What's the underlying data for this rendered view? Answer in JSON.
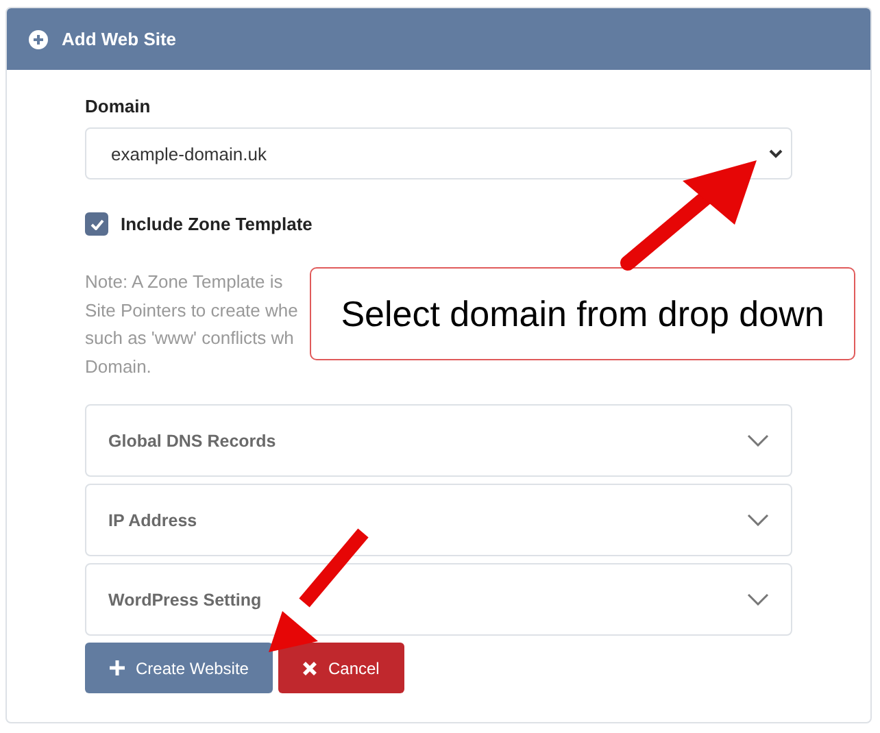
{
  "panel": {
    "title": "Add Web Site"
  },
  "domain": {
    "label": "Domain",
    "value": "example-domain.uk"
  },
  "include_zone_template": {
    "label": "Include Zone Template",
    "checked": true
  },
  "note_lines": [
    "Note: A Zone Template is",
    "Site Pointers to create whe",
    "such as 'www' conflicts wh",
    "Domain."
  ],
  "sections": [
    {
      "title": "Global DNS Records",
      "expanded": false
    },
    {
      "title": "IP Address",
      "expanded": false
    },
    {
      "title": "WordPress Setting",
      "expanded": false
    }
  ],
  "buttons": [
    {
      "kind": "primary",
      "label": "Create Website"
    },
    {
      "kind": "danger",
      "label": "Cancel"
    }
  ],
  "callout": {
    "text": "Select domain from drop down"
  }
}
